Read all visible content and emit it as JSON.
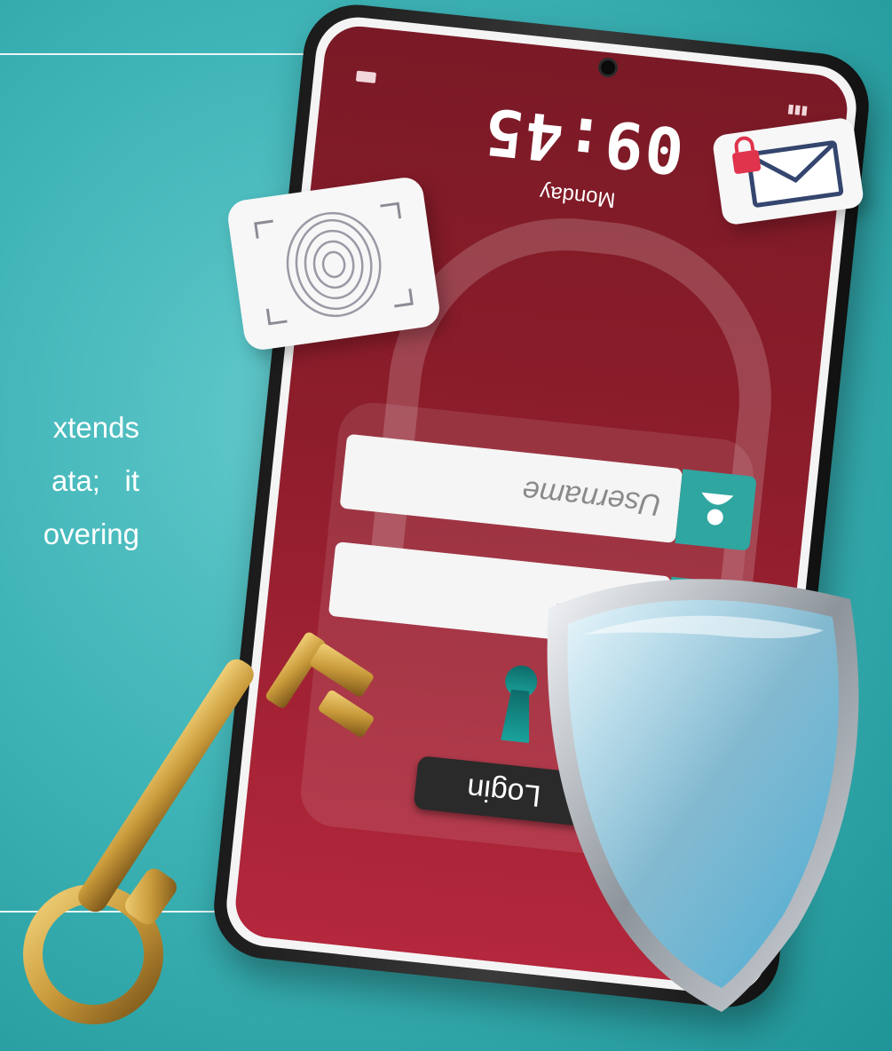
{
  "article": {
    "text_lines": [
      "xtends",
      "ata;   it",
      "overing"
    ]
  },
  "phone": {
    "clock": "09:45",
    "day": "Monday",
    "username_placeholder": "Username",
    "password_value": "********",
    "login_label": "Login"
  },
  "colors": {
    "background": "#3eb4b7",
    "screen": "#8e1d2b",
    "accent": "#2fa6a0",
    "login_button": "#2a2a2a"
  },
  "icons": [
    "fingerprint-icon",
    "mail-lock-icon",
    "user-icon",
    "padlock-icon",
    "keyhole-icon",
    "shield-icon",
    "key-icon"
  ]
}
